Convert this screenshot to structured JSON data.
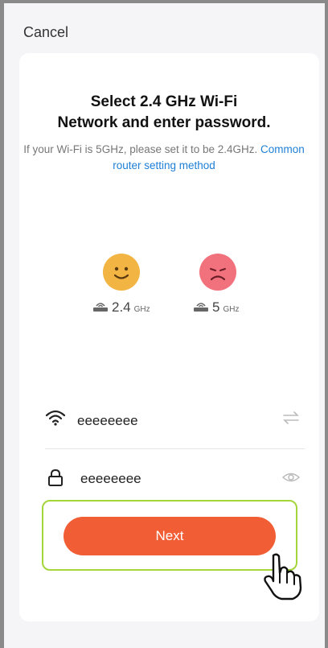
{
  "header": {
    "cancel_label": "Cancel"
  },
  "title": {
    "line1": "Select 2.4 GHz Wi-Fi",
    "line2": "Network and enter password."
  },
  "subtitle": {
    "text": "If your Wi-Fi is 5GHz, please set it to be 2.4GHz. ",
    "link": "Common router setting method"
  },
  "bands": [
    {
      "value": "2.4",
      "unit": "GHz",
      "status": "supported",
      "face_color": "#f2b443"
    },
    {
      "value": "5",
      "unit": "GHz",
      "status": "unsupported",
      "face_color": "#f1727d"
    }
  ],
  "wifi": {
    "ssid": "eeeeeeee",
    "icon": "wifi-icon",
    "action_icon": "switch-arrows-icon"
  },
  "password": {
    "value": "eeeeeeee",
    "icon": "lock-icon",
    "action_icon": "eye-icon"
  },
  "next_button": {
    "label": "Next",
    "color": "#f15e36"
  },
  "colors": {
    "link": "#1e7fd6",
    "highlight": "#a4d63c"
  }
}
